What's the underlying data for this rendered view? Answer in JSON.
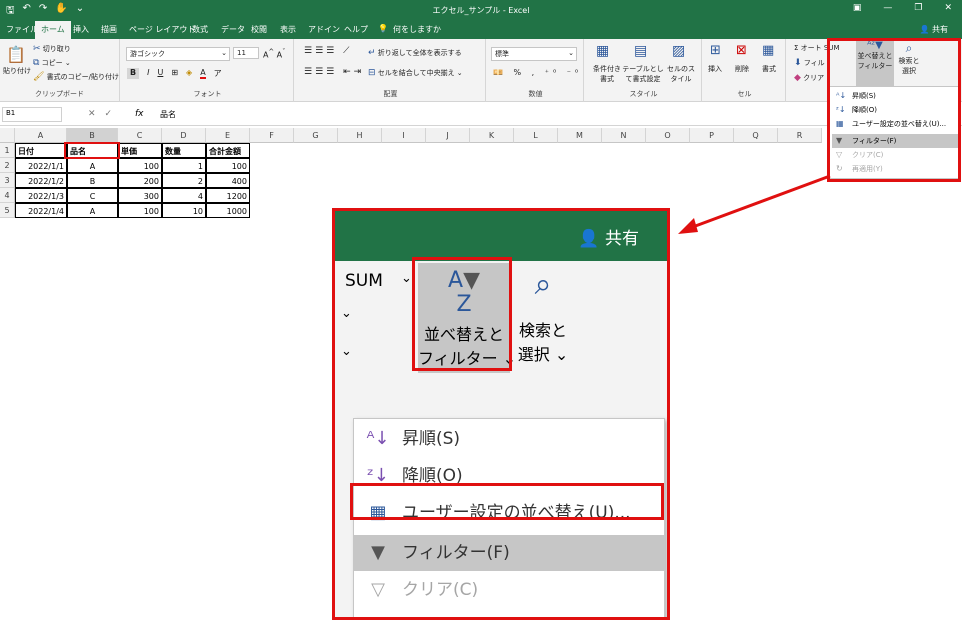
{
  "window": {
    "title": "エクセル_サンプル - Excel"
  },
  "tabs": [
    "ファイル",
    "ホーム",
    "挿入",
    "描画",
    "ページ レイアウト",
    "数式",
    "データ",
    "校閲",
    "表示",
    "アドイン",
    "ヘルプ"
  ],
  "tell_me": "何をしますか",
  "share": "共有",
  "ribbon": {
    "clipboard": {
      "paste": "貼り付け",
      "cut": "切り取り",
      "copy": "コピー",
      "format_painter": "書式のコピー/貼り付け",
      "label": "クリップボード"
    },
    "font": {
      "name": "游ゴシック",
      "size": "11",
      "label": "フォント"
    },
    "alignment": {
      "wrap": "折り返して全体を表示する",
      "merge": "セルを結合して中央揃え",
      "label": "配置"
    },
    "number": {
      "format": "標準",
      "label": "数値"
    },
    "styles": {
      "conditional": "条件付き書式",
      "table": "テーブルとして書式設定",
      "cell": "セルのスタイル",
      "label": "スタイル"
    },
    "cells": {
      "insert": "挿入",
      "delete": "削除",
      "format": "書式",
      "label": "セル"
    },
    "editing": {
      "autosum": "オート SUM",
      "fill": "フィル",
      "clear": "クリア",
      "sort_filter": "並べ替えとフィルター",
      "find_select": "検索と選択"
    }
  },
  "formula_bar": {
    "name_box": "B1",
    "fx": "fx",
    "content": "品名"
  },
  "columns": [
    "A",
    "B",
    "C",
    "D",
    "E",
    "F",
    "G",
    "H",
    "I",
    "J",
    "K",
    "L",
    "M",
    "N",
    "O",
    "P",
    "Q",
    "R"
  ],
  "rows": [
    "1",
    "2",
    "3",
    "4",
    "5"
  ],
  "table": {
    "headers": [
      "日付",
      "品名",
      "単価",
      "数量",
      "合計金額"
    ],
    "data": [
      [
        "2022/1/1",
        "A",
        "100",
        "1",
        "100"
      ],
      [
        "2022/1/2",
        "B",
        "200",
        "2",
        "400"
      ],
      [
        "2022/1/3",
        "C",
        "300",
        "4",
        "1200"
      ],
      [
        "2022/1/4",
        "A",
        "100",
        "10",
        "1000"
      ]
    ]
  },
  "menu": {
    "items": [
      {
        "label": "昇順(S)",
        "icon": "sort-ascending-icon",
        "enabled": true
      },
      {
        "label": "降順(O)",
        "icon": "sort-descending-icon",
        "enabled": true
      },
      {
        "label": "ユーザー設定の並べ替え(U)...",
        "icon": "custom-sort-icon",
        "enabled": true
      },
      {
        "label": "フィルター(F)",
        "icon": "filter-icon",
        "enabled": true,
        "highlighted": true
      },
      {
        "label": "クリア(C)",
        "icon": "clear-filter-icon",
        "enabled": false
      },
      {
        "label": "再適用(Y)",
        "icon": "reapply-icon",
        "enabled": false
      }
    ]
  },
  "zoom": {
    "sum": "SUM",
    "sort_line1": "並べ替えと",
    "sort_line2": "フィルター",
    "find_line1": "検索と",
    "find_line2": "選択"
  },
  "colors": {
    "excel_green": "#217346",
    "highlight_red": "#e01010",
    "menu_highlight": "#c6c6c6"
  }
}
